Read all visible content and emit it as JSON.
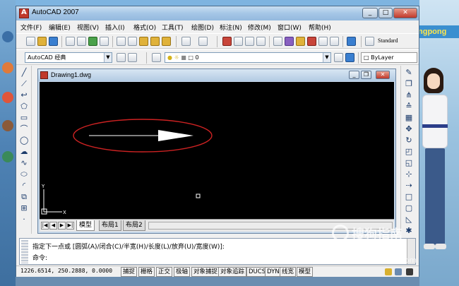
{
  "window": {
    "title": "AutoCAD 2007",
    "controls": {
      "minimize": "_",
      "maximize": "□",
      "close": "✕"
    }
  },
  "menu": [
    "文件(F)",
    "编辑(E)",
    "视图(V)",
    "插入(I)",
    "格式(O)",
    "工具(T)",
    "绘图(D)",
    "标注(N)",
    "修改(M)",
    "窗口(W)",
    "帮助(H)"
  ],
  "toolbar": {
    "text_style": "Standard",
    "workspace": "AutoCAD 经典",
    "layer": "0",
    "color": "ByLayer"
  },
  "drawing": {
    "title": "Drawing1.dwg",
    "annotation_color": "#cc2222",
    "arrow_color": "#ffffff",
    "canvas_bg": "#000000",
    "ucs_y": "Y",
    "ucs_x": "X"
  },
  "layout_tabs": {
    "nav": [
      "|◀",
      "◀",
      "▶",
      "▶|"
    ],
    "tabs": [
      "模型",
      "布局1",
      "布局2"
    ],
    "active": "模型"
  },
  "command": {
    "prompt": "指定下一点或 [圆弧(A)/闭合(C)/半宽(H)/长度(L)/放弃(U)/宽度(W)]:",
    "input_label": "命令:"
  },
  "status": {
    "coordinates": "1226.6514, 250.2888, 0.0000",
    "toggles": [
      "捕捉",
      "栅格",
      "正交",
      "极轴",
      "对象捕捉",
      "对象追踪",
      "DUCS",
      "DYN",
      "线宽",
      "模型"
    ]
  },
  "desktop": {
    "banner": "ngpong",
    "watermark": "搜狗指南",
    "watermark_url": "zhinan.sogou.com"
  }
}
